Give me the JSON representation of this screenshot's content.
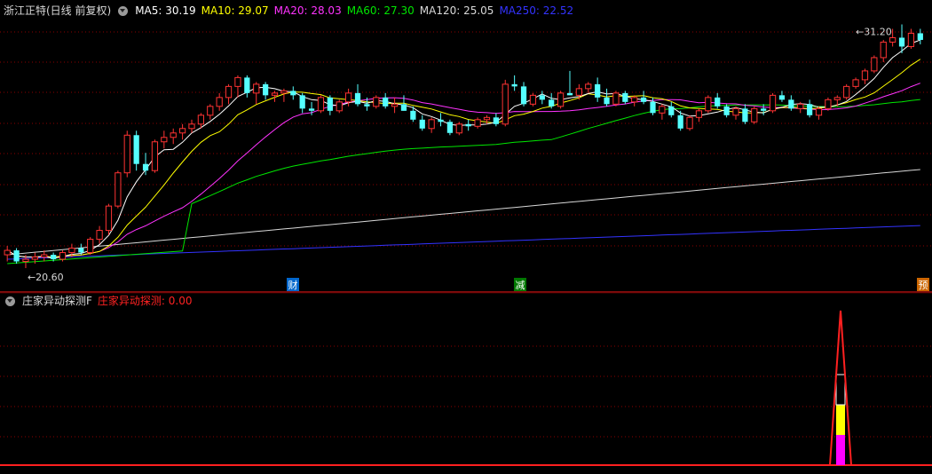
{
  "header": {
    "title": "浙江正特(日线 前复权)",
    "ma": [
      {
        "label": "MA5: 30.19",
        "color": "#ffffff"
      },
      {
        "label": "MA10: 29.07",
        "color": "#ffff00"
      },
      {
        "label": "MA20: 28.03",
        "color": "#ff33ff"
      },
      {
        "label": "MA60: 27.30",
        "color": "#00e600"
      },
      {
        "label": "MA120: 25.05",
        "color": "#d8d8d8"
      },
      {
        "label": "MA250: 22.52",
        "color": "#3333ff"
      }
    ]
  },
  "price_panel": {
    "high_label": "31.20",
    "low_label": "20.60",
    "markers": [
      {
        "text": "财",
        "bg": "#0066cc",
        "fg": "#ffffff"
      },
      {
        "text": "减",
        "bg": "#007700",
        "fg": "#ffffff"
      },
      {
        "text": "预",
        "bg": "#cc6600",
        "fg": "#ffffff"
      }
    ]
  },
  "indicator": {
    "name": "庄家异动探测F",
    "value_label": "庄家异动探测: 0.00",
    "value_color": "#ff2222"
  },
  "colors": {
    "up": "#ff3333",
    "down": "#55ffff",
    "grid": "#8b0000",
    "axis": "#b01010",
    "spike_fill_1": "#ff00ff",
    "spike_fill_2": "#ffff00"
  },
  "chart_data": {
    "type": "candlestick",
    "candles": [
      [
        21.2,
        21.6,
        20.9,
        21.4
      ],
      [
        21.4,
        21.5,
        20.8,
        20.9
      ],
      [
        20.9,
        21.2,
        20.6,
        21.0
      ],
      [
        21.0,
        21.3,
        20.8,
        21.1
      ],
      [
        21.1,
        21.4,
        20.9,
        21.2
      ],
      [
        21.2,
        21.3,
        20.9,
        21.0
      ],
      [
        21.0,
        21.4,
        20.9,
        21.3
      ],
      [
        21.3,
        21.7,
        21.1,
        21.5
      ],
      [
        21.5,
        21.7,
        21.2,
        21.3
      ],
      [
        21.3,
        22.0,
        21.2,
        21.9
      ],
      [
        21.9,
        22.5,
        21.7,
        22.3
      ],
      [
        22.3,
        23.5,
        22.1,
        23.4
      ],
      [
        23.4,
        25.0,
        23.3,
        24.9
      ],
      [
        24.9,
        26.8,
        24.7,
        26.6
      ],
      [
        26.6,
        26.8,
        25.0,
        25.3
      ],
      [
        25.3,
        25.8,
        24.8,
        25.0
      ],
      [
        25.0,
        26.4,
        24.9,
        26.3
      ],
      [
        26.3,
        26.8,
        26.0,
        26.5
      ],
      [
        26.5,
        26.9,
        26.2,
        26.7
      ],
      [
        26.7,
        27.1,
        26.4,
        26.9
      ],
      [
        26.9,
        27.3,
        26.7,
        27.1
      ],
      [
        27.1,
        27.6,
        26.9,
        27.5
      ],
      [
        27.5,
        28.0,
        27.3,
        27.9
      ],
      [
        27.9,
        28.5,
        27.7,
        28.3
      ],
      [
        28.3,
        28.9,
        28.0,
        28.8
      ],
      [
        28.8,
        29.3,
        28.3,
        29.2
      ],
      [
        29.2,
        29.3,
        28.3,
        28.5
      ],
      [
        28.5,
        29.0,
        28.0,
        28.9
      ],
      [
        28.9,
        29.0,
        28.2,
        28.4
      ],
      [
        28.4,
        28.6,
        28.1,
        28.5
      ],
      [
        28.5,
        28.7,
        28.1,
        28.6
      ],
      [
        28.6,
        28.8,
        28.2,
        28.4
      ],
      [
        28.4,
        28.5,
        27.6,
        27.8
      ],
      [
        27.8,
        28.1,
        27.5,
        27.7
      ],
      [
        27.7,
        28.4,
        27.6,
        28.3
      ],
      [
        28.3,
        28.4,
        27.5,
        27.7
      ],
      [
        27.7,
        28.2,
        27.6,
        28.1
      ],
      [
        28.1,
        28.7,
        27.9,
        28.5
      ],
      [
        28.5,
        28.9,
        27.9,
        28.0
      ],
      [
        28.0,
        28.3,
        27.7,
        27.9
      ],
      [
        27.9,
        28.4,
        27.8,
        28.3
      ],
      [
        28.3,
        28.5,
        27.8,
        27.9
      ],
      [
        27.9,
        28.3,
        27.6,
        28.0
      ],
      [
        28.0,
        28.4,
        27.7,
        27.7
      ],
      [
        27.7,
        27.9,
        27.2,
        27.3
      ],
      [
        27.3,
        27.5,
        26.8,
        26.9
      ],
      [
        26.9,
        27.4,
        26.7,
        27.3
      ],
      [
        27.3,
        27.6,
        27.0,
        27.2
      ],
      [
        27.2,
        27.3,
        26.6,
        26.7
      ],
      [
        26.7,
        27.2,
        26.6,
        27.1
      ],
      [
        27.1,
        27.3,
        26.8,
        27.0
      ],
      [
        27.0,
        27.4,
        26.9,
        27.3
      ],
      [
        27.3,
        27.5,
        27.1,
        27.4
      ],
      [
        27.4,
        27.6,
        27.0,
        27.1
      ],
      [
        27.1,
        29.1,
        27.0,
        28.9
      ],
      [
        28.9,
        29.3,
        28.6,
        28.8
      ],
      [
        28.8,
        29.0,
        27.9,
        28.0
      ],
      [
        28.0,
        28.5,
        27.9,
        28.4
      ],
      [
        28.4,
        28.6,
        28.0,
        28.2
      ],
      [
        28.2,
        28.5,
        27.8,
        27.9
      ],
      [
        27.9,
        28.6,
        27.8,
        28.5
      ],
      [
        28.5,
        29.5,
        28.4,
        28.4
      ],
      [
        28.4,
        28.9,
        28.2,
        28.7
      ],
      [
        28.7,
        29.0,
        28.5,
        28.9
      ],
      [
        28.9,
        29.2,
        28.1,
        28.3
      ],
      [
        28.3,
        28.7,
        27.9,
        28.0
      ],
      [
        28.0,
        28.6,
        27.9,
        28.5
      ],
      [
        28.5,
        28.6,
        28.0,
        28.1
      ],
      [
        28.1,
        28.4,
        27.9,
        28.3
      ],
      [
        28.3,
        28.6,
        28.0,
        28.1
      ],
      [
        28.1,
        28.3,
        27.5,
        27.6
      ],
      [
        27.6,
        28.0,
        27.3,
        27.9
      ],
      [
        27.9,
        28.1,
        27.4,
        27.5
      ],
      [
        27.5,
        27.7,
        26.8,
        26.9
      ],
      [
        26.9,
        27.5,
        26.8,
        27.4
      ],
      [
        27.4,
        27.8,
        27.2,
        27.7
      ],
      [
        27.7,
        28.4,
        27.6,
        28.3
      ],
      [
        28.3,
        28.5,
        27.8,
        27.9
      ],
      [
        27.9,
        28.0,
        27.4,
        27.5
      ],
      [
        27.5,
        27.9,
        27.3,
        27.8
      ],
      [
        27.8,
        28.0,
        27.1,
        27.2
      ],
      [
        27.2,
        27.9,
        27.1,
        27.8
      ],
      [
        27.8,
        28.0,
        27.5,
        27.7
      ],
      [
        27.7,
        28.5,
        27.6,
        28.4
      ],
      [
        28.4,
        28.6,
        28.1,
        28.2
      ],
      [
        28.2,
        28.4,
        27.7,
        27.8
      ],
      [
        27.8,
        28.1,
        27.6,
        28.0
      ],
      [
        28.0,
        28.2,
        27.4,
        27.5
      ],
      [
        27.5,
        27.9,
        27.3,
        27.8
      ],
      [
        27.8,
        28.3,
        27.7,
        28.2
      ],
      [
        28.2,
        28.4,
        27.9,
        28.3
      ],
      [
        28.3,
        28.9,
        28.2,
        28.8
      ],
      [
        28.8,
        29.2,
        28.7,
        29.1
      ],
      [
        29.1,
        29.6,
        28.9,
        29.5
      ],
      [
        29.5,
        30.2,
        29.4,
        30.1
      ],
      [
        30.1,
        30.9,
        29.9,
        30.8
      ],
      [
        30.8,
        31.4,
        30.6,
        31.0
      ],
      [
        31.0,
        31.6,
        30.3,
        30.6
      ],
      [
        30.6,
        31.4,
        30.5,
        31.2
      ],
      [
        31.2,
        31.4,
        30.7,
        30.9
      ]
    ],
    "ylim": [
      20.2,
      31.9
    ],
    "indicator_series": "spike near the end of the series, 0 elsewhere"
  }
}
